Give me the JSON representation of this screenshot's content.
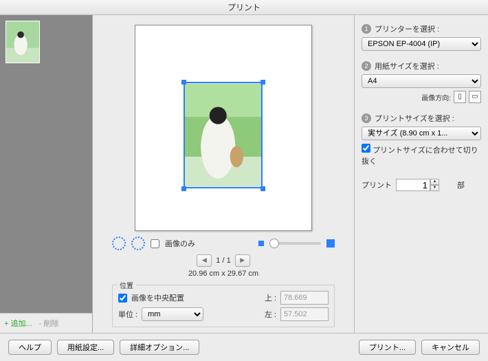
{
  "window": {
    "title": "プリント"
  },
  "left": {
    "add": "+ 追加...",
    "del": "- 削除"
  },
  "mid": {
    "image_only": "画像のみ",
    "page_indicator": "1 / 1",
    "paper_dims": "20.96 cm x 29.67 cm",
    "position": {
      "legend": "位置",
      "center": "画像を中央配置",
      "unit_label": "単位 :",
      "unit_value": "mm",
      "top_label": "上 :",
      "top_value": "78.669",
      "left_label": "左 :",
      "left_value": "57.502"
    }
  },
  "right": {
    "s1": {
      "num": "1",
      "label": "プリンターを選択 :",
      "value": "EPSON EP-4004 (IP)"
    },
    "s2": {
      "num": "2",
      "label": "用紙サイズを選択 :",
      "value": "A4",
      "orient_label": "画像方向:"
    },
    "s3": {
      "num": "3",
      "label": "プリントサイズを選択 :",
      "value": "実サイズ (8.90 cm x 1...",
      "crop": "プリントサイズに合わせて切り抜く"
    },
    "copies": {
      "label": "プリント",
      "value": "1",
      "unit": "部"
    }
  },
  "footer": {
    "help": "ヘルプ",
    "page_setup": "用紙設定...",
    "options": "詳細オプション...",
    "print": "プリント...",
    "cancel": "キャンセル"
  }
}
